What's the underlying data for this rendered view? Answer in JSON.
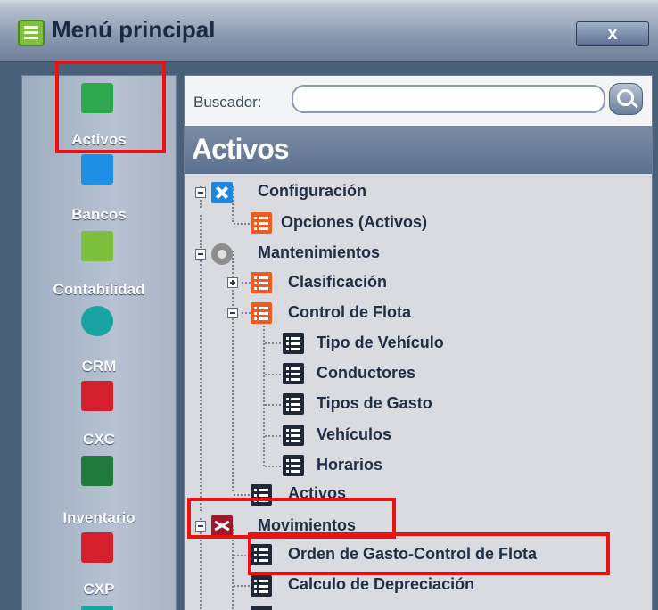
{
  "window": {
    "title": "Menú principal",
    "close_label": "x"
  },
  "sidebar": {
    "items": [
      {
        "label": "Activos",
        "icon": "cash-register-icon",
        "color": "#2fa84f"
      },
      {
        "label": "Bancos",
        "icon": "briefcase-icon",
        "color": "#1f8fe6"
      },
      {
        "label": "Contabilidad",
        "icon": "chart-icon",
        "color": "#7fbf3f"
      },
      {
        "label": "CRM",
        "icon": "globe-icon",
        "color": "#1aa3a3"
      },
      {
        "label": "CXC",
        "icon": "person-icon",
        "color": "#d61f2c"
      },
      {
        "label": "Inventario",
        "icon": "worker-icon",
        "color": "#1f7a3a"
      },
      {
        "label": "CXP",
        "icon": "person-money-icon",
        "color": "#d61f2c"
      }
    ]
  },
  "search": {
    "label": "Buscador:",
    "value": "",
    "placeholder": ""
  },
  "section": {
    "title": "Activos"
  },
  "tree": [
    {
      "label": "Configuración",
      "icon": "tools-icon"
    },
    {
      "label": "Opciones (Activos)",
      "icon": "list-icon"
    },
    {
      "label": "Mantenimientos",
      "icon": "gear-icon"
    },
    {
      "label": "Clasificación",
      "icon": "list-icon"
    },
    {
      "label": "Control de Flota",
      "icon": "list-icon"
    },
    {
      "label": "Tipo de Vehículo",
      "icon": "list-icon"
    },
    {
      "label": "Conductores",
      "icon": "list-icon"
    },
    {
      "label": "Tipos de Gasto",
      "icon": "list-icon"
    },
    {
      "label": "Vehículos",
      "icon": "list-icon"
    },
    {
      "label": "Horarios",
      "icon": "list-icon"
    },
    {
      "label": "Activos",
      "icon": "list-icon"
    },
    {
      "label": "Movimientos",
      "icon": "shuffle-icon"
    },
    {
      "label": "Orden de Gasto-Control de Flota",
      "icon": "list-icon"
    },
    {
      "label": "Calculo de Depreciación",
      "icon": "list-icon"
    }
  ],
  "colors": {
    "highlight": "#ee1111",
    "accent_orange": "#ee5c22"
  }
}
